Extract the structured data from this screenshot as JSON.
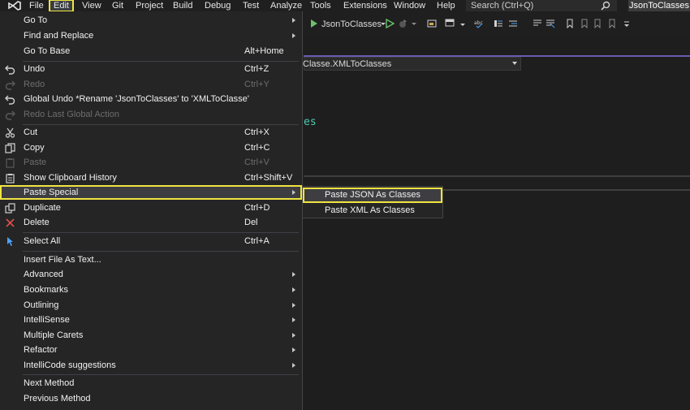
{
  "menubar": {
    "logo_icon": "visual-studio-logo-icon",
    "items": [
      "File",
      "Edit",
      "View",
      "Git",
      "Project",
      "Build",
      "Debug",
      "Test",
      "Analyze",
      "Tools",
      "Extensions",
      "Window",
      "Help"
    ],
    "search_placeholder": "Search (Ctrl+Q)",
    "project_title": "JsonToClasses"
  },
  "toolbar": {
    "start_target": "JsonToClasses"
  },
  "editor": {
    "nav_dropdown": "Classe.XMLToClasses",
    "code_fragment": "es"
  },
  "edit_menu": {
    "items": [
      {
        "label": "Go To",
        "shortcut": "",
        "submenu": true,
        "icon": ""
      },
      {
        "label": "Find and Replace",
        "shortcut": "",
        "submenu": true,
        "icon": ""
      },
      {
        "label": "Go To Base",
        "shortcut": "Alt+Home",
        "icon": ""
      },
      {
        "label": "Undo",
        "shortcut": "Ctrl+Z",
        "icon": "undo-icon"
      },
      {
        "label": "Redo",
        "shortcut": "Ctrl+Y",
        "icon": "redo-icon",
        "disabled": true
      },
      {
        "label": "Global Undo *Rename 'JsonToClasses' to 'XMLToClasse'",
        "shortcut": "",
        "icon": "global-undo-icon"
      },
      {
        "label": "Redo Last Global Action",
        "shortcut": "",
        "icon": "global-redo-icon",
        "disabled": true
      },
      {
        "label": "Cut",
        "shortcut": "Ctrl+X",
        "icon": "cut-icon"
      },
      {
        "label": "Copy",
        "shortcut": "Ctrl+C",
        "icon": "copy-icon"
      },
      {
        "label": "Paste",
        "shortcut": "Ctrl+V",
        "icon": "paste-icon",
        "disabled": true
      },
      {
        "label": "Show Clipboard History",
        "shortcut": "Ctrl+Shift+V",
        "icon": "clipboard-icon"
      },
      {
        "label": "Paste Special",
        "shortcut": "",
        "submenu": true,
        "icon": ""
      },
      {
        "label": "Duplicate",
        "shortcut": "Ctrl+D",
        "icon": "duplicate-icon"
      },
      {
        "label": "Delete",
        "shortcut": "Del",
        "icon": "delete-icon"
      },
      {
        "label": "Select All",
        "shortcut": "Ctrl+A",
        "icon": "select-all-icon"
      },
      {
        "label": "Insert File As Text...",
        "shortcut": "",
        "icon": ""
      },
      {
        "label": "Advanced",
        "shortcut": "",
        "submenu": true,
        "icon": ""
      },
      {
        "label": "Bookmarks",
        "shortcut": "",
        "submenu": true,
        "icon": ""
      },
      {
        "label": "Outlining",
        "shortcut": "",
        "submenu": true,
        "icon": ""
      },
      {
        "label": "IntelliSense",
        "shortcut": "",
        "submenu": true,
        "icon": ""
      },
      {
        "label": "Multiple Carets",
        "shortcut": "",
        "submenu": true,
        "icon": ""
      },
      {
        "label": "Refactor",
        "shortcut": "",
        "submenu": true,
        "icon": ""
      },
      {
        "label": "IntelliCode suggestions",
        "shortcut": "",
        "submenu": true,
        "icon": ""
      },
      {
        "label": "Next Method",
        "shortcut": "",
        "icon": ""
      },
      {
        "label": "Previous Method",
        "shortcut": "",
        "icon": ""
      }
    ]
  },
  "paste_special_menu": {
    "items": [
      "Paste JSON As Classes",
      "Paste XML As Classes"
    ]
  },
  "colors": {
    "highlight": "#f0e442",
    "accent_purple": "#6b5bb2"
  }
}
